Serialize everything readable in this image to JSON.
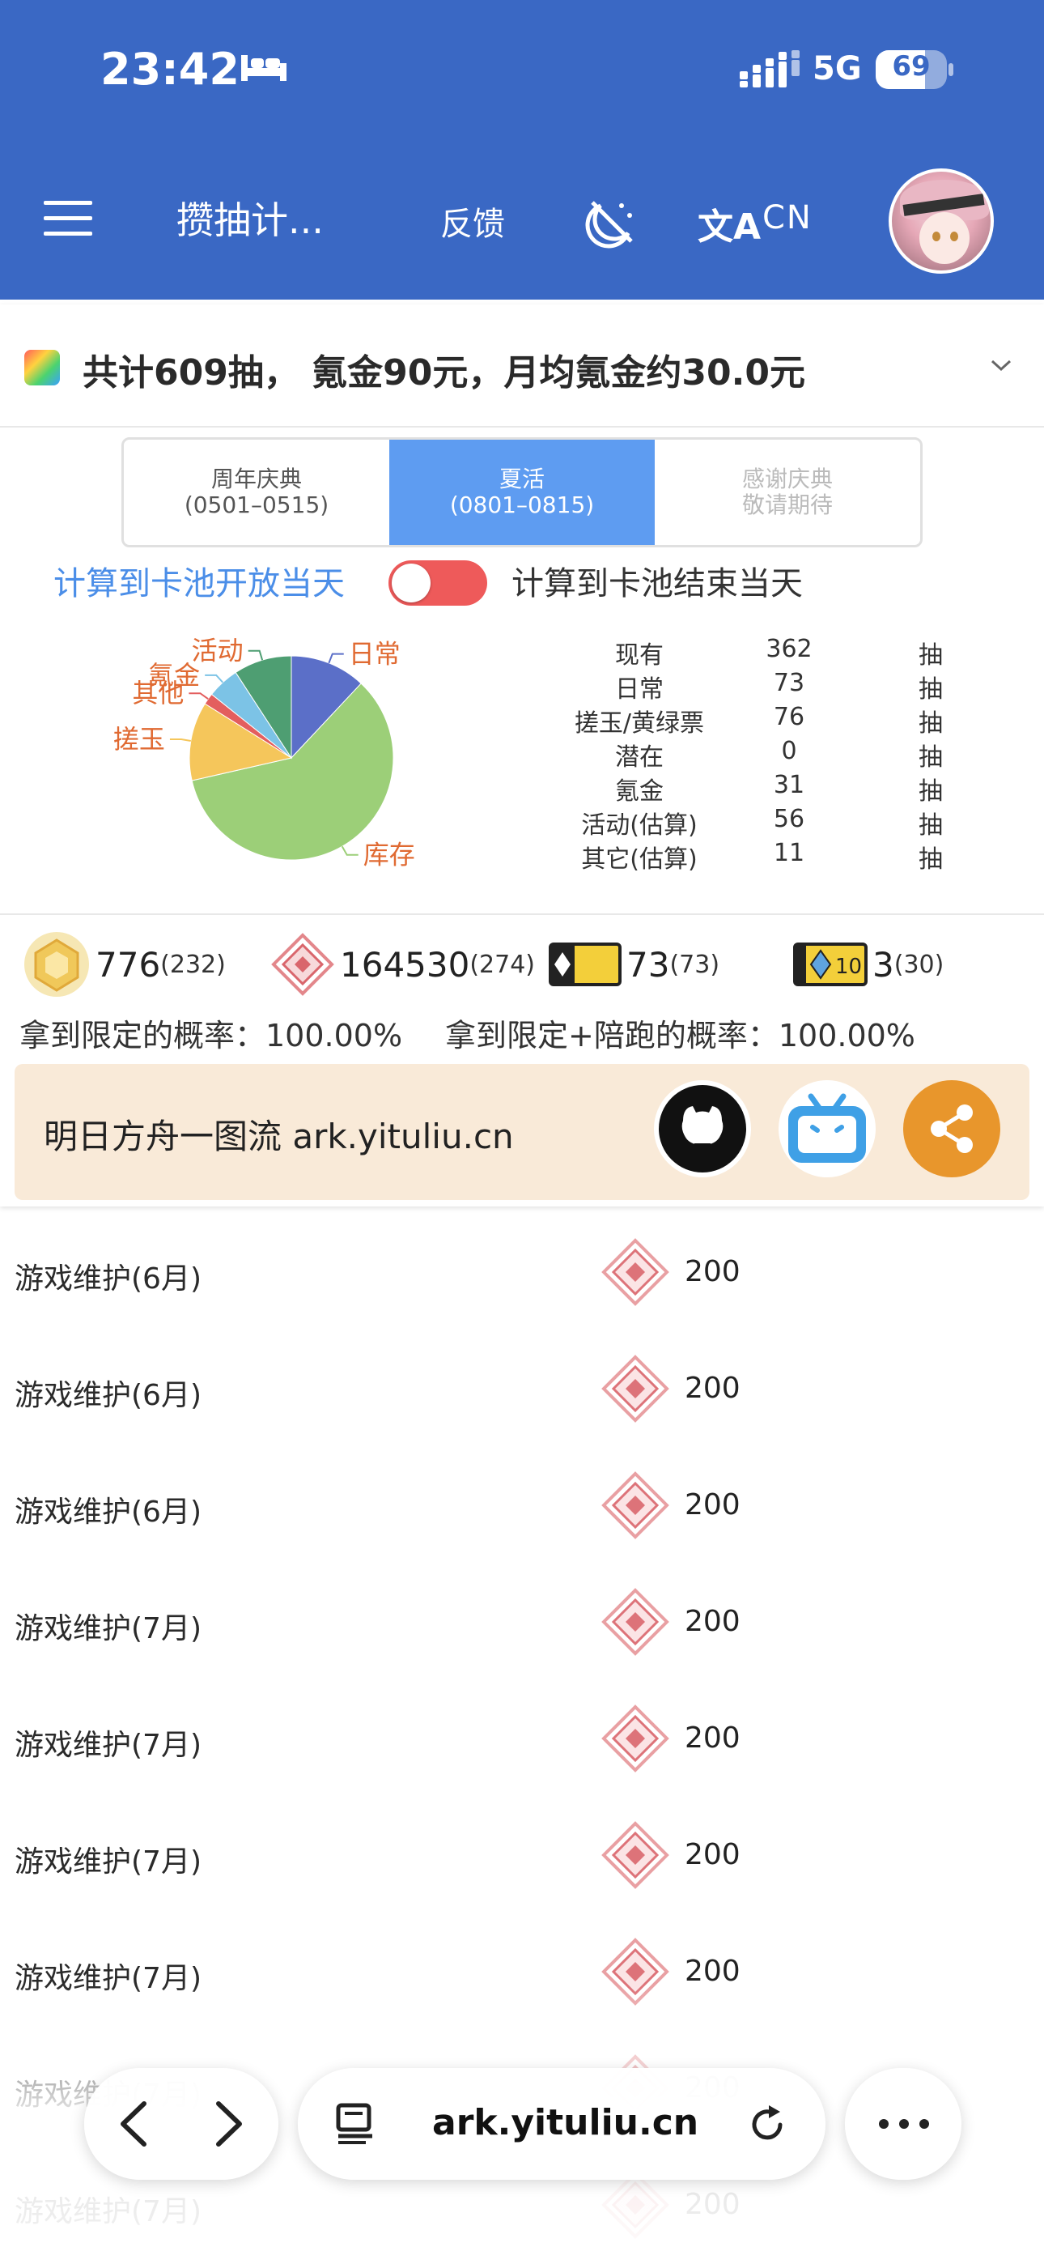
{
  "status_bar": {
    "time": "23:42",
    "network": "5G",
    "battery": "69",
    "battery_level": 0.69
  },
  "appbar": {
    "title": "攒抽计...",
    "feedback": "反馈",
    "lang": "CN"
  },
  "summary": {
    "text": "共计609抽， 氪金90元，月均氪金约30.0元"
  },
  "tabs": [
    {
      "line1": "周年庆典",
      "line2": "(0501–0515)",
      "state": "normal"
    },
    {
      "line1": "夏活",
      "line2": "(0801–0815)",
      "state": "active"
    },
    {
      "line1": "感谢庆典",
      "line2": "敬请期待",
      "state": "disabled"
    }
  ],
  "calc": {
    "left": "计算到卡池开放当天",
    "right": "计算到卡池结束当天",
    "toggle_on": true
  },
  "chart_data": {
    "type": "pie",
    "slices": [
      {
        "label": "日常",
        "value": 73,
        "color": "#5b6fc8"
      },
      {
        "label": "库存",
        "value": 362,
        "color": "#9ccf78"
      },
      {
        "label": "搓玉",
        "value": 76,
        "color": "#f5c65b"
      },
      {
        "label": "其他",
        "value": 11,
        "color": "#e35e5e"
      },
      {
        "label": "氪金",
        "value": 31,
        "color": "#7cc3e6"
      },
      {
        "label": "活动",
        "value": 56,
        "color": "#4e9e72"
      }
    ],
    "label_colors": {
      "text": "#e06a32"
    }
  },
  "stats": [
    {
      "k": "现有",
      "v": "362",
      "u": "抽"
    },
    {
      "k": "日常",
      "v": "73",
      "u": "抽"
    },
    {
      "k": "搓玉/黄绿票",
      "v": "76",
      "u": "抽"
    },
    {
      "k": "潜在",
      "v": "0",
      "u": "抽"
    },
    {
      "k": "氪金",
      "v": "31",
      "u": "抽"
    },
    {
      "k": "活动(估算)",
      "v": "56",
      "u": "抽"
    },
    {
      "k": "其它(估算)",
      "v": "11",
      "u": "抽"
    }
  ],
  "resources": [
    {
      "icon": "originium-icon",
      "num": "776",
      "sub": "(232)"
    },
    {
      "icon": "orundum-icon",
      "num": "164530",
      "sub": "(274)"
    },
    {
      "icon": "permit-icon",
      "num": "73",
      "sub": "(73)"
    },
    {
      "icon": "ten-permit-icon",
      "num": "3",
      "sub": "(30)"
    }
  ],
  "probability": {
    "limited": "拿到限定的概率：100.00%",
    "limited_plus": "拿到限定+陪跑的概率：100.00%"
  },
  "banner": {
    "text": "明日方舟一图流 ark.yituliu.cn"
  },
  "list_items": [
    {
      "name": "游戏维护(6月)",
      "amount": "200"
    },
    {
      "name": "游戏维护(6月)",
      "amount": "200"
    },
    {
      "name": "游戏维护(6月)",
      "amount": "200"
    },
    {
      "name": "游戏维护(7月)",
      "amount": "200"
    },
    {
      "name": "游戏维护(7月)",
      "amount": "200"
    },
    {
      "name": "游戏维护(7月)",
      "amount": "200"
    },
    {
      "name": "游戏维护(7月)",
      "amount": "200"
    },
    {
      "name": "游戏维护(7月)",
      "amount": "200"
    },
    {
      "name": "游戏维护(7月)",
      "amount": "200"
    }
  ],
  "browser": {
    "url": "ark.yituliu.cn"
  }
}
